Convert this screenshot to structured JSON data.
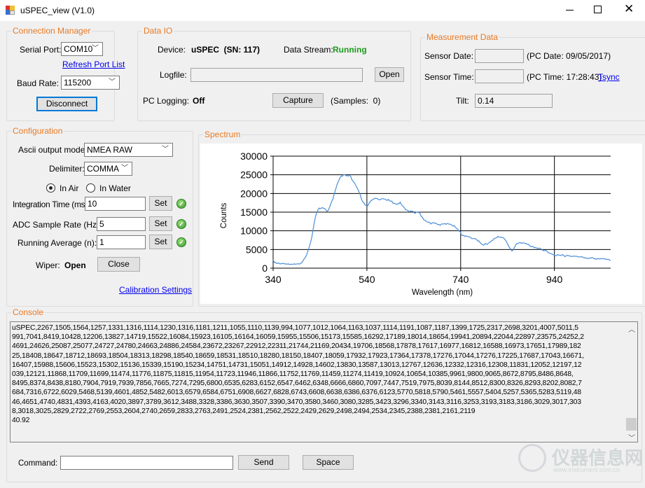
{
  "window": {
    "title": "uSPEC_view (V1.0)",
    "icon": "app-icon",
    "controls": [
      "minimize-icon",
      "maximize-icon",
      "close-icon"
    ]
  },
  "colors": {
    "group_legend": "#e87a24",
    "running": "#1a9a1a",
    "link": "#0000ee",
    "series": "#4a8fd8"
  },
  "connection": {
    "legend": "Connection Manager",
    "serial_port_label": "Serial Port:",
    "serial_port": "COM10",
    "refresh": "Refresh Port List",
    "baud_label": "Baud Rate:",
    "baud": "115200",
    "disconnect": "Disconnect"
  },
  "data_io": {
    "legend": "Data IO",
    "device_label": "Device:",
    "device": "uSPEC  (SN: 117)",
    "stream_label": "Data Stream:",
    "stream": "Running",
    "logfile_label": "Logfile:",
    "logfile": "",
    "open": "Open",
    "logging_label": "PC Logging:",
    "logging": "Off",
    "capture": "Capture",
    "samples": "(Samples:  0)"
  },
  "measurement": {
    "legend": "Measurement Data",
    "date_label": "Sensor Date:",
    "date": "",
    "pc_date": "(PC Date: 09/05/2017)",
    "time_label": "Sensor Time:",
    "time": "",
    "pc_time": "(PC Time: 17:28:43)",
    "tsync": "Tsync",
    "tilt_label": "Tilt:",
    "tilt": "0.14"
  },
  "config": {
    "legend": "Configuration",
    "ascii_label": "Ascii output mode:",
    "ascii": "NMEA RAW",
    "delim_label": "Delimiter:",
    "delim": "COMMA",
    "in_air": "In Air",
    "in_water": "In Water",
    "medium_selected": "In Air",
    "integration_label": "Integration Time (ms):",
    "integration": "10",
    "adc_label": "ADC Sample Rate (Hz):",
    "adc": "5",
    "avg_label": "Running Average (n):",
    "avg": "1",
    "set": "Set",
    "wiper_label": "Wiper:",
    "wiper": "Open",
    "close": "Close",
    "calibration": "Calibration Settings"
  },
  "spectrum": {
    "legend": "Spectrum"
  },
  "chart_data": {
    "type": "line",
    "title": "",
    "xlabel": "Wavelength (nm)",
    "ylabel": "Counts",
    "xlim": [
      340,
      1060
    ],
    "ylim": [
      0,
      30000
    ],
    "xticks": [
      340,
      540,
      740,
      940
    ],
    "yticks": [
      0,
      5000,
      10000,
      15000,
      20000,
      25000,
      30000
    ],
    "grid": true,
    "legend": "none",
    "x_first": 340,
    "x_last": 1060,
    "values": [
      2267,
      1505,
      1564,
      1257,
      1331,
      1316,
      1114,
      1230,
      1316,
      1181,
      1211,
      1055,
      1110,
      1139,
      994,
      1077,
      1012,
      1064,
      1163,
      1037,
      1114,
      1191,
      1087,
      1187,
      1399,
      1725,
      2317,
      2698,
      3201,
      4007,
      5011,
      5991,
      7041,
      8419,
      10428,
      12206,
      13827,
      14719,
      15522,
      16084,
      15923,
      16105,
      16164,
      16059,
      15955,
      15506,
      15173,
      15585,
      16292,
      17189,
      18014,
      18654,
      19941,
      20894,
      22044,
      22897,
      23575,
      24252,
      24691,
      24626,
      25087,
      25077,
      24727,
      24780,
      24663,
      24886,
      24584,
      23672,
      23267,
      22912,
      22311,
      21744,
      21169,
      20434,
      19706,
      18568,
      17878,
      17617,
      16977,
      16812,
      16588,
      16973,
      17651,
      17989,
      18225,
      18408,
      18647,
      18712,
      18693,
      18504,
      18313,
      18298,
      18540,
      18659,
      18531,
      18510,
      18280,
      18150,
      18407,
      18059,
      17932,
      17923,
      17364,
      17378,
      17276,
      17044,
      17276,
      17225,
      17687,
      17043,
      16671,
      16407,
      15988,
      15606,
      15523,
      15302,
      15136,
      15339,
      15190,
      15234,
      14751,
      14731,
      15051,
      14912,
      14928,
      14602,
      13830,
      13587,
      13013,
      12767,
      12636,
      12332,
      12316,
      12308,
      11831,
      12052,
      12197,
      12039,
      12121,
      11868,
      11709,
      11699,
      11474,
      11776,
      11875,
      11815,
      11954,
      11723,
      11946,
      11866,
      11752,
      11769,
      11459,
      11274,
      11419,
      10924,
      10654,
      10385,
      9961,
      9800,
      9065,
      8672,
      8795,
      8486,
      8648,
      8495,
      8374,
      8438,
      8180,
      7904,
      7919,
      7939,
      7856,
      7665,
      7274,
      7295,
      6800,
      6535,
      6283,
      6152,
      6547,
      6462,
      6348,
      6666,
      6860,
      7097,
      7447,
      7519,
      7975,
      8039,
      8144,
      8512,
      8300,
      8326,
      8293,
      8202,
      8082,
      7684,
      7316,
      6722,
      6029,
      5468,
      5139,
      4601,
      4852,
      5482,
      6013,
      6579,
      6584,
      6751,
      6908,
      6627,
      6828,
      6743,
      6608,
      6638,
      6386,
      6376,
      6123,
      5770,
      5818,
      5790,
      5461,
      5557,
      5404,
      5257,
      5365,
      5283,
      5119,
      4846,
      4651,
      4740,
      4831,
      4393,
      4163,
      4020,
      3897,
      3789,
      3612,
      3488,
      3328,
      3386,
      3630,
      3507,
      3390,
      3470,
      3580,
      3460,
      3080,
      3285,
      3423,
      3296,
      3340,
      3143,
      3116,
      3253,
      3193,
      3183,
      3186,
      3029,
      3017,
      3038,
      3018,
      3025,
      2829,
      2722,
      2769,
      2553,
      2604,
      2740,
      2659,
      2833,
      2763,
      2491,
      2524,
      2381,
      2562,
      2522,
      2429,
      2629,
      2498,
      2494,
      2534,
      2345,
      2388,
      2381,
      2161,
      2119
    ]
  },
  "console": {
    "legend": "Console",
    "lines": [
      "uSPEC,2267,1505,1564,1257,1331,1316,1114,1230,1316,1181,1211,1055,1110,1139,994,1077,1012,1064,1163,1037,1114,1191,1087,1187,1399,1725,2317,2698,3201,4007,5011,5",
      "991,7041,8419,10428,12206,13827,14719,15522,16084,15923,16105,16164,16059,15955,15506,15173,15585,16292,17189,18014,18654,19941,20894,22044,22897,23575,24252,2",
      "4691,24626,25087,25077,24727,24780,24663,24886,24584,23672,23267,22912,22311,21744,21169,20434,19706,18568,17878,17617,16977,16812,16588,16973,17651,17989,182",
      "25,18408,18647,18712,18693,18504,18313,18298,18540,18659,18531,18510,18280,18150,18407,18059,17932,17923,17364,17378,17276,17044,17276,17225,17687,17043,16671,",
      "16407,15988,15606,15523,15302,15136,15339,15190,15234,14751,14731,15051,14912,14928,14602,13830,13587,13013,12767,12636,12332,12316,12308,11831,12052,12197,12",
      "039,12121,11868,11709,11699,11474,11776,11875,11815,11954,11723,11946,11866,11752,11769,11459,11274,11419,10924,10654,10385,9961,9800,9065,8672,8795,8486,8648,",
      "8495,8374,8438,8180,7904,7919,7939,7856,7665,7274,7295,6800,6535,6283,6152,6547,6462,6348,6666,6860,7097,7447,7519,7975,8039,8144,8512,8300,8326,8293,8202,8082,7",
      "684,7316,6722,6029,5468,5139,4601,4852,5482,6013,6579,6584,6751,6908,6627,6828,6743,6608,6638,6386,6376,6123,5770,5818,5790,5461,5557,5404,5257,5365,5283,5119,48",
      "46,4651,4740,4831,4393,4163,4020,3897,3789,3612,3488,3328,3386,3630,3507,3390,3470,3580,3460,3080,3285,3423,3296,3340,3143,3116,3253,3193,3183,3186,3029,3017,303",
      "8,3018,3025,2829,2722,2769,2553,2604,2740,2659,2833,2763,2491,2524,2381,2562,2522,2429,2629,2498,2494,2534,2345,2388,2381,2161,2119",
      "40.92"
    ],
    "command_label": "Command:",
    "command": "",
    "send": "Send",
    "space": "Space"
  },
  "watermark": {
    "text": "仪器信息网",
    "url": "www.instrument.com.cn"
  }
}
